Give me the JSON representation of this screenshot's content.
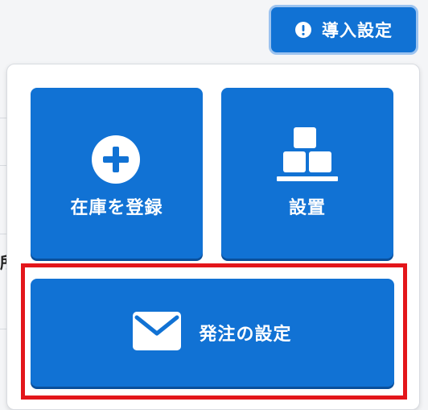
{
  "header": {
    "setup_button_label": "導入設定",
    "setup_icon": "exclamation-circle-icon"
  },
  "menu": {
    "tiles": [
      {
        "label": "在庫を登録",
        "icon": "plus-circle-icon"
      },
      {
        "label": "設置",
        "icon": "boxes-stack-icon"
      },
      {
        "label": "発注の設定",
        "icon": "envelope-icon"
      }
    ]
  },
  "background": {
    "partial_text": "所"
  },
  "colors": {
    "primary": "#1172d4",
    "primary_shadow": "#0a4f9b",
    "highlight": "#e3161b",
    "setup_border": "#9cc3ef"
  }
}
